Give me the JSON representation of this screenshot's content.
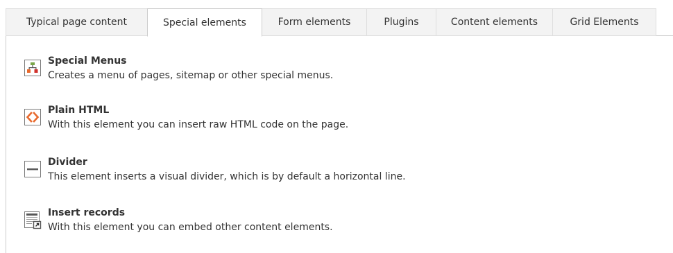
{
  "tabs": [
    {
      "label": "Typical page content",
      "active": false
    },
    {
      "label": "Special elements",
      "active": true
    },
    {
      "label": "Form elements",
      "active": false
    },
    {
      "label": "Plugins",
      "active": false
    },
    {
      "label": "Content elements",
      "active": false
    },
    {
      "label": "Grid Elements",
      "active": false
    }
  ],
  "items": [
    {
      "title": "Special Menus",
      "description": "Creates a menu of pages, sitemap or other special menus.",
      "icon": "sitemap-icon"
    },
    {
      "title": "Plain HTML",
      "description": "With this element you can insert raw HTML code on the page.",
      "icon": "html-code-icon"
    },
    {
      "title": "Divider",
      "description": "This element inserts a visual divider, which is by default a horizontal line.",
      "icon": "divider-icon"
    },
    {
      "title": "Insert records",
      "description": "With this element you can embed other content elements.",
      "icon": "insert-records-icon"
    }
  ],
  "colors": {
    "accent_orange": "#e8692c",
    "accent_red": "#d0312d",
    "accent_green": "#79a548",
    "icon_gray": "#575757"
  }
}
